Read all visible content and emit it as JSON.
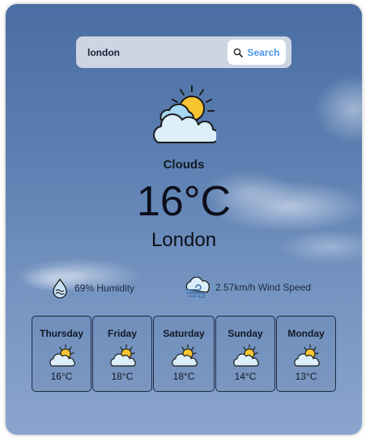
{
  "search": {
    "value": "london",
    "button_label": "Search"
  },
  "current": {
    "icon": "sun-behind-clouds-icon",
    "condition": "Clouds",
    "temperature": "16°C",
    "city": "London"
  },
  "stats": {
    "humidity": "69% Humidity",
    "wind": "2.57km/h Wind Speed"
  },
  "forecast": [
    {
      "day": "Thursday",
      "temp": "16°C",
      "icon": "sun-behind-clouds-icon"
    },
    {
      "day": "Friday",
      "temp": "18°C",
      "icon": "sun-behind-clouds-icon"
    },
    {
      "day": "Saturday",
      "temp": "18°C",
      "icon": "sun-behind-clouds-icon"
    },
    {
      "day": "Sunday",
      "temp": "14°C",
      "icon": "sun-behind-clouds-icon"
    },
    {
      "day": "Monday",
      "temp": "13°C",
      "icon": "sun-behind-clouds-icon"
    }
  ],
  "colors": {
    "accent": "#4c93e6",
    "sun": "#f8c530",
    "cloud": "#dbeefa"
  }
}
